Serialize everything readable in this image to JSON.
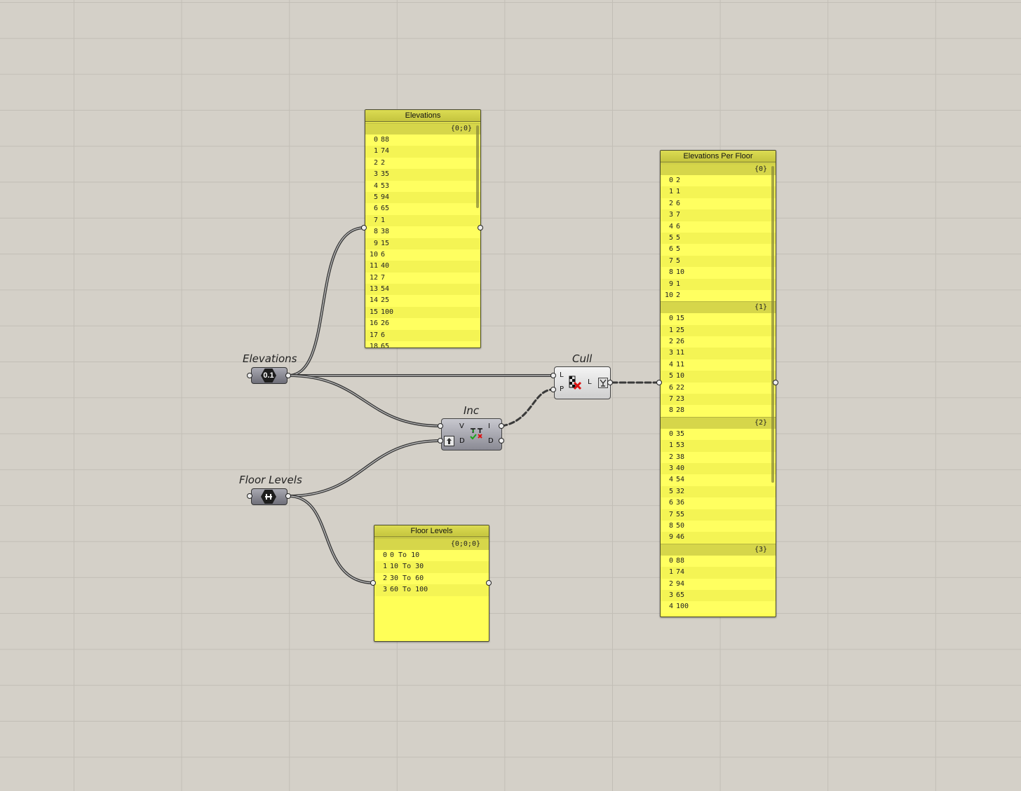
{
  "elevations_param": {
    "label": "Elevations",
    "icon_text": "0.1",
    "icon": "number-param-icon"
  },
  "floor_levels_param": {
    "label": "Floor Levels",
    "icon": "domain-param-icon"
  },
  "inc_component": {
    "label": "Inc",
    "in_v": "V",
    "in_d": "D",
    "out_i": "I",
    "out_d": "D",
    "icon": "includes-icon",
    "flip_icon": "flip-arrow-icon"
  },
  "cull_component": {
    "label": "Cull",
    "in_l": "L",
    "in_p": "P",
    "out_l": "L",
    "icon": "cull-pattern-icon",
    "inverse_icon": "filter-icon"
  },
  "elevations_panel": {
    "title": "Elevations",
    "branches": [
      {
        "path": "{0;0}",
        "items": [
          {
            "i": "0",
            "v": "88"
          },
          {
            "i": "1",
            "v": "74"
          },
          {
            "i": "2",
            "v": "2"
          },
          {
            "i": "3",
            "v": "35"
          },
          {
            "i": "4",
            "v": "53"
          },
          {
            "i": "5",
            "v": "94"
          },
          {
            "i": "6",
            "v": "65"
          },
          {
            "i": "7",
            "v": "1"
          },
          {
            "i": "8",
            "v": "38"
          },
          {
            "i": "9",
            "v": "15"
          },
          {
            "i": "10",
            "v": "6"
          },
          {
            "i": "11",
            "v": "40"
          },
          {
            "i": "12",
            "v": "7"
          },
          {
            "i": "13",
            "v": "54"
          },
          {
            "i": "14",
            "v": "25"
          },
          {
            "i": "15",
            "v": "100"
          },
          {
            "i": "16",
            "v": "26"
          },
          {
            "i": "17",
            "v": "6"
          },
          {
            "i": "18",
            "v": "65"
          }
        ]
      }
    ]
  },
  "floor_levels_panel": {
    "title": "Floor Levels",
    "branches": [
      {
        "path": "{0;0;0}",
        "items": [
          {
            "i": "0",
            "v": "0 To 10"
          },
          {
            "i": "1",
            "v": "10 To 30"
          },
          {
            "i": "2",
            "v": "30 To 60"
          },
          {
            "i": "3",
            "v": "60 To 100"
          }
        ]
      }
    ]
  },
  "elevations_per_floor_panel": {
    "title": "Elevations Per Floor",
    "branches": [
      {
        "path": "{0}",
        "items": [
          {
            "i": "0",
            "v": "2"
          },
          {
            "i": "1",
            "v": "1"
          },
          {
            "i": "2",
            "v": "6"
          },
          {
            "i": "3",
            "v": "7"
          },
          {
            "i": "4",
            "v": "6"
          },
          {
            "i": "5",
            "v": "5"
          },
          {
            "i": "6",
            "v": "5"
          },
          {
            "i": "7",
            "v": "5"
          },
          {
            "i": "8",
            "v": "10"
          },
          {
            "i": "9",
            "v": "1"
          },
          {
            "i": "10",
            "v": "2"
          }
        ]
      },
      {
        "path": "{1}",
        "items": [
          {
            "i": "0",
            "v": "15"
          },
          {
            "i": "1",
            "v": "25"
          },
          {
            "i": "2",
            "v": "26"
          },
          {
            "i": "3",
            "v": "11"
          },
          {
            "i": "4",
            "v": "11"
          },
          {
            "i": "5",
            "v": "10"
          },
          {
            "i": "6",
            "v": "22"
          },
          {
            "i": "7",
            "v": "23"
          },
          {
            "i": "8",
            "v": "28"
          }
        ]
      },
      {
        "path": "{2}",
        "items": [
          {
            "i": "0",
            "v": "35"
          },
          {
            "i": "1",
            "v": "53"
          },
          {
            "i": "2",
            "v": "38"
          },
          {
            "i": "3",
            "v": "40"
          },
          {
            "i": "4",
            "v": "54"
          },
          {
            "i": "5",
            "v": "32"
          },
          {
            "i": "6",
            "v": "36"
          },
          {
            "i": "7",
            "v": "55"
          },
          {
            "i": "8",
            "v": "50"
          },
          {
            "i": "9",
            "v": "46"
          }
        ]
      },
      {
        "path": "{3}",
        "items": [
          {
            "i": "0",
            "v": "88"
          },
          {
            "i": "1",
            "v": "74"
          },
          {
            "i": "2",
            "v": "94"
          },
          {
            "i": "3",
            "v": "65"
          },
          {
            "i": "4",
            "v": "100"
          }
        ]
      }
    ]
  }
}
